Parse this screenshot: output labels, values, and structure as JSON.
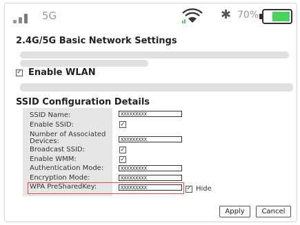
{
  "status_bar": {
    "network": "5G",
    "battery_percent": "70%",
    "battery_level": 0.7,
    "icons": [
      "signal-bars-icon",
      "wifi-icon",
      "bluetooth-icon",
      "battery-icon"
    ],
    "battery_color": "#4cd35e"
  },
  "basic": {
    "title": "2.4G/5G Basic Network Settings",
    "enable_wlan_label": "Enable WLAN",
    "enable_wlan_checked": true
  },
  "ssid": {
    "title": "SSID Configuration Details",
    "rows": [
      {
        "label": "SSID Name:",
        "type": "text",
        "value": "XXXXXXXXX"
      },
      {
        "label": "Enable SSID:",
        "type": "checkbox",
        "checked": true
      },
      {
        "label": "Number of Associated Devices:",
        "type": "text",
        "value": "XXXXXXXXX"
      },
      {
        "label": "Broadcast SSID:",
        "type": "checkbox",
        "checked": true
      },
      {
        "label": "Enable WMM:",
        "type": "checkbox",
        "checked": true
      },
      {
        "label": "Authentication Mode:",
        "type": "text",
        "value": "XXXXXXXXX"
      },
      {
        "label": "Encryption Mode:",
        "type": "text",
        "value": "XXXXXXXXX"
      },
      {
        "label": "WPA PreSharedKey:",
        "type": "text",
        "value": "XXXXXXXXX"
      }
    ],
    "hide_label": "Hide",
    "hide_checked": true,
    "highlight_color": "#e04848"
  },
  "buttons": {
    "apply": "Apply",
    "cancel": "Cancel"
  }
}
